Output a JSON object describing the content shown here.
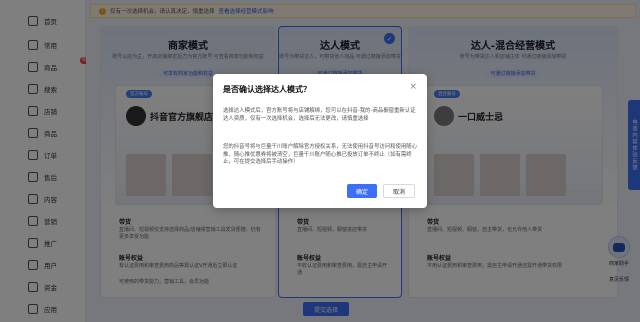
{
  "sidebar": {
    "items": [
      {
        "label": "首页",
        "icon": "home-icon"
      },
      {
        "label": "常用",
        "icon": "star-icon"
      },
      {
        "label": "商品",
        "icon": "bag-icon",
        "badge": "新"
      },
      {
        "label": "搜索",
        "icon": "search-icon"
      },
      {
        "label": "店铺",
        "icon": "store-icon"
      },
      {
        "label": "商品",
        "icon": "box-icon"
      },
      {
        "label": "订单",
        "icon": "order-icon"
      },
      {
        "label": "售后",
        "icon": "aftersale-icon"
      },
      {
        "label": "内容",
        "icon": "content-icon"
      },
      {
        "label": "营销",
        "icon": "marketing-icon"
      },
      {
        "label": "推广",
        "icon": "promote-icon"
      },
      {
        "label": "用户",
        "icon": "user-icon"
      },
      {
        "label": "资金",
        "icon": "wallet-icon"
      },
      {
        "label": "应用",
        "icon": "apps-icon"
      }
    ]
  },
  "notice": {
    "text": "仅有一次选择机会，请认真决定，慎重选择",
    "link": "查看选择经营模式影响"
  },
  "cards": [
    {
      "title": "商家模式",
      "sub": "账号以店为主，开启店铺绑定后方为官方账号\n可查看商家功能和权益",
      "tag": "可享有商家功能和权益",
      "shop_name": "抖音官方旗舰店",
      "pill": "官方账号",
      "rights_h": "带货",
      "rights_t": "直播间、短视频仅支持选择商品/店铺常营销工具发货便捷、仍有更多享受功能",
      "acct_h": "账号权益",
      "acct_t": "有认证费用和审查费用商品等需认证V开通后立即认证",
      "acct_t2": "可使用的带货能力，营销工具，会员功能"
    },
    {
      "title": "达人模式",
      "sub": "账号为带货达人，可带货他人商品\n可通过链接添加带货",
      "tag": "可通过链接添加带货",
      "rights_h": "带货",
      "rights_t": "直播间、短视频，橱窗进店带货",
      "acct_h": "账号权益",
      "acct_t": "不收认证费用和审查费用，需自主申请开通"
    },
    {
      "title": "达人-混合经营模式",
      "sub": "账号为带货达人和店铺主体\n可通过链接添加带货",
      "tag": "可通过链接添加带货",
      "shop_name": "一口威士忌",
      "pill": "混合账号",
      "rights_h": "带货",
      "rights_t": "直播间、短视频、橱窗，自主带货，也允许他人带货",
      "acct_h": "账号权益",
      "acct_t": "不用认证费用和审查费用，需自主申请开通还需开通带货权限"
    }
  ],
  "submit_label": "提交选择",
  "feedback_label": "电商内容体验反馈",
  "bot_label_1": "商家助手",
  "bot_label_2": "意见反馈",
  "dialog": {
    "title": "是否确认选择达人模式？",
    "close": "×",
    "para1": "选择达人模式后，官方账号将与店铺解绑，您可以在抖音-我的-商品橱窗重新认证达人资质，仅有一次选择机会，选择后无法更改，请慎重选择",
    "para2": "您的抖音号将与巨量千川账户解除官方授权关系，无法使用抖音号访问和使用随心推、随心推优惠券将被清空，巨量千川账户随心推已投放订单不终止（如有需终止，可在提交选择后手动操作）",
    "ok": "确定",
    "cancel": "取消"
  },
  "colors": {
    "accent": "#3b6ff5",
    "overlay": "rgba(0,0,0,0.5)"
  }
}
